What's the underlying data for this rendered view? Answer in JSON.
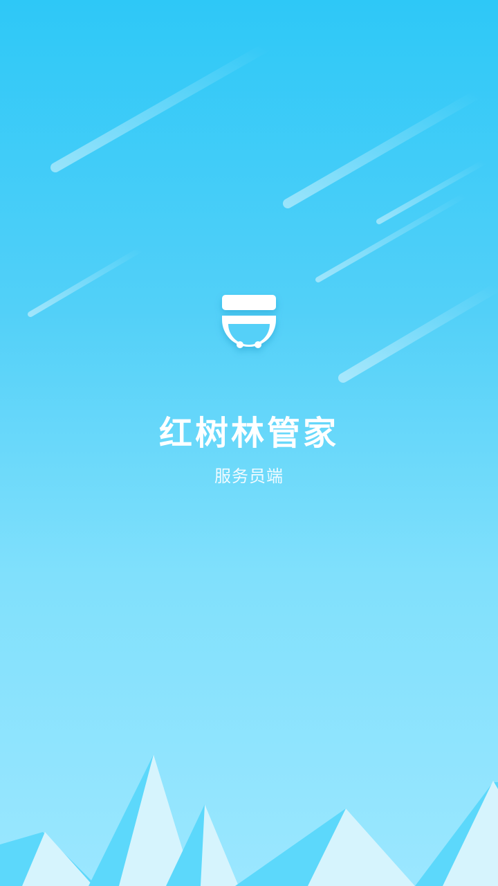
{
  "app": {
    "title": "红树林管家",
    "subtitle": "服务员端"
  },
  "icons": {
    "logo": "waiter-face-icon"
  },
  "colors": {
    "background_top": "#2ec8f7",
    "background_bottom": "#9be7ff",
    "text": "#ffffff",
    "mountain_light": "#d6f4fd",
    "mountain_shadow": "#5cd8fb"
  }
}
